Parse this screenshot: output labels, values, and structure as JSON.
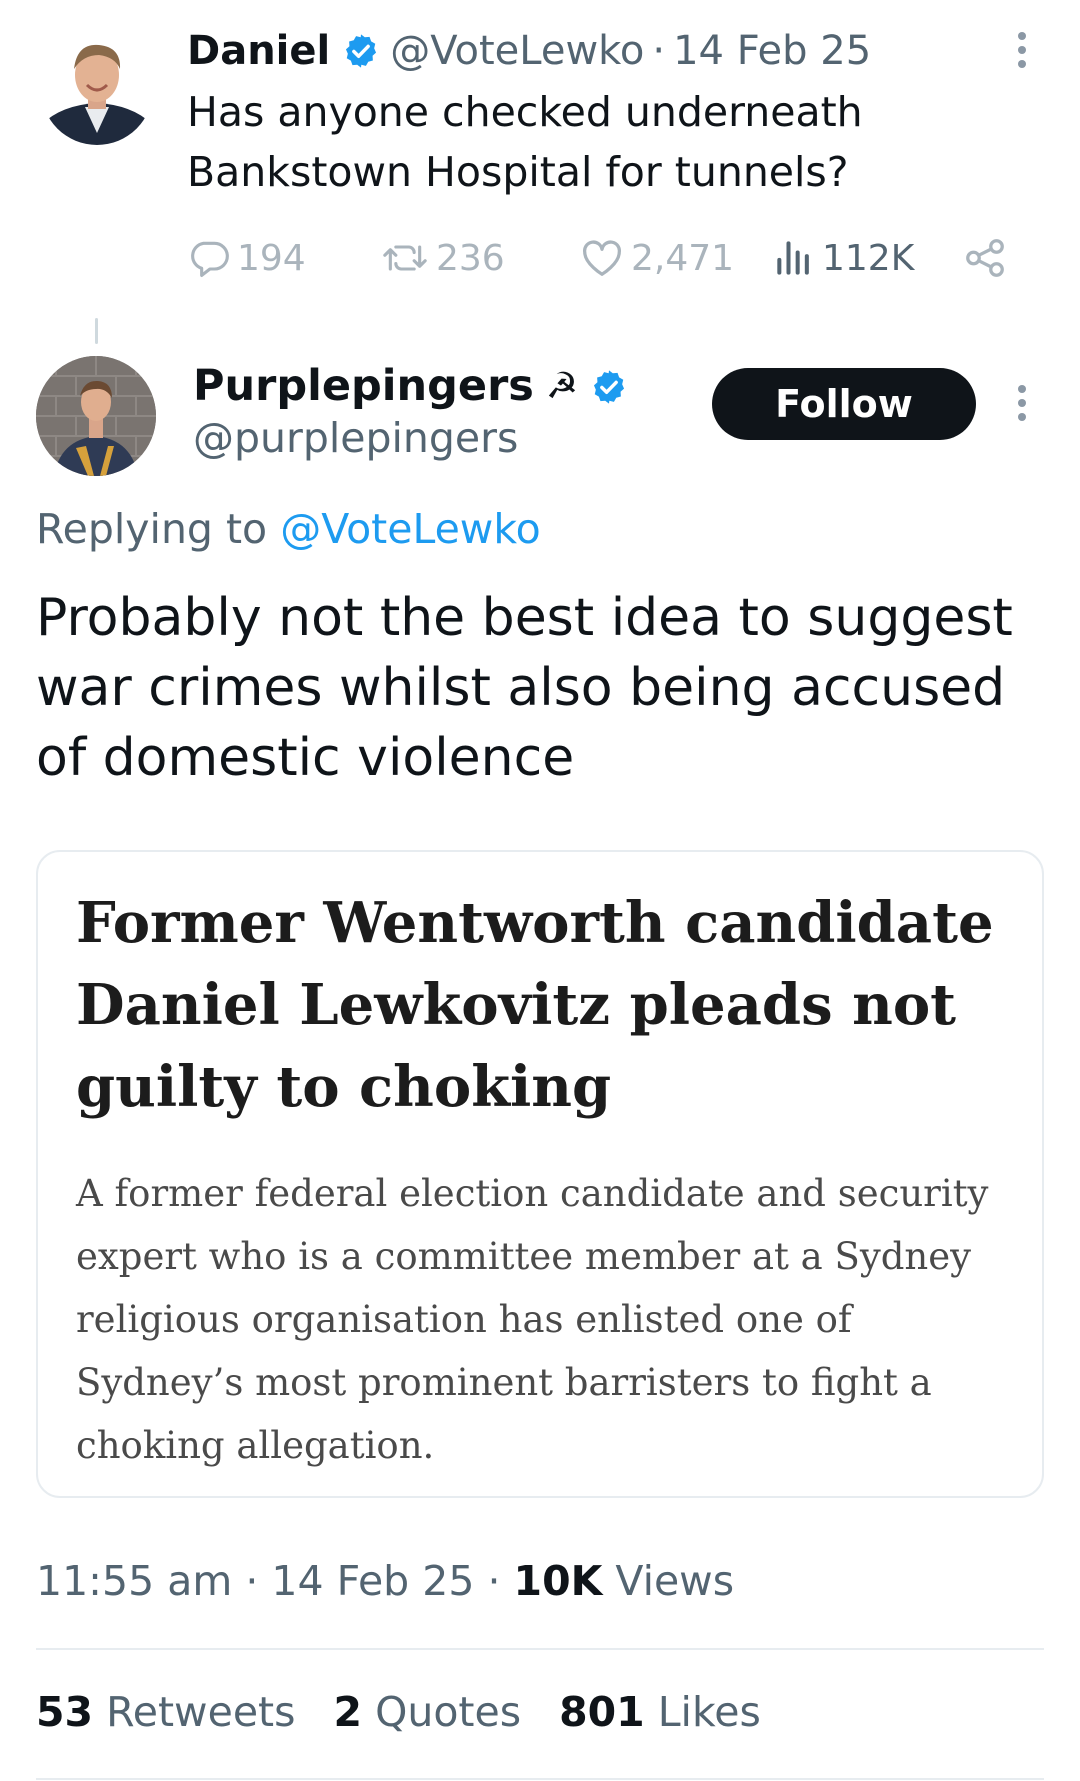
{
  "parent_tweet": {
    "author_name": "Daniel",
    "handle": "@VoteLewko",
    "separator": "·",
    "date": "14 Feb 25",
    "text": "Has anyone checked underneath Bankstown Hospital for tunnels?",
    "replies": "194",
    "retweets": "236",
    "likes": "2,471",
    "views": "112K"
  },
  "reply_tweet": {
    "author_name": "Purplepingers",
    "name_emoji": "☭",
    "handle": "@purplepingers",
    "follow_label": "Follow",
    "replying_prefix": "Replying to",
    "replying_handle": "@VoteLewko",
    "text": "Probably not the best idea to suggest war crimes whilst also being accused of domestic violence",
    "card": {
      "title": "Former Wentworth candidate Daniel Lewkovitz pleads not guilty to choking",
      "description": "A former federal election candidate and security expert who is a committee member at a Sydney religious organisation has enlisted one of Sydney’s most prominent barristers to fight a choking allegation."
    },
    "time": "11:55 am",
    "date": "14 Feb 25",
    "separator": "·",
    "views_count": "10K",
    "views_label": "Views",
    "retweets_count": "53",
    "retweets_label": "Retweets",
    "quotes_count": "2",
    "quotes_label": "Quotes",
    "likes_count": "801",
    "likes_label": "Likes"
  },
  "colors": {
    "verified": "#1d9bf0",
    "link": "#1d9bf0",
    "secondary_text": "#536471",
    "follow_button": "#0f1419"
  },
  "icons": [
    "verified-badge-icon",
    "reply-icon",
    "retweet-icon",
    "like-icon",
    "views-icon",
    "share-icon",
    "more-icon"
  ]
}
